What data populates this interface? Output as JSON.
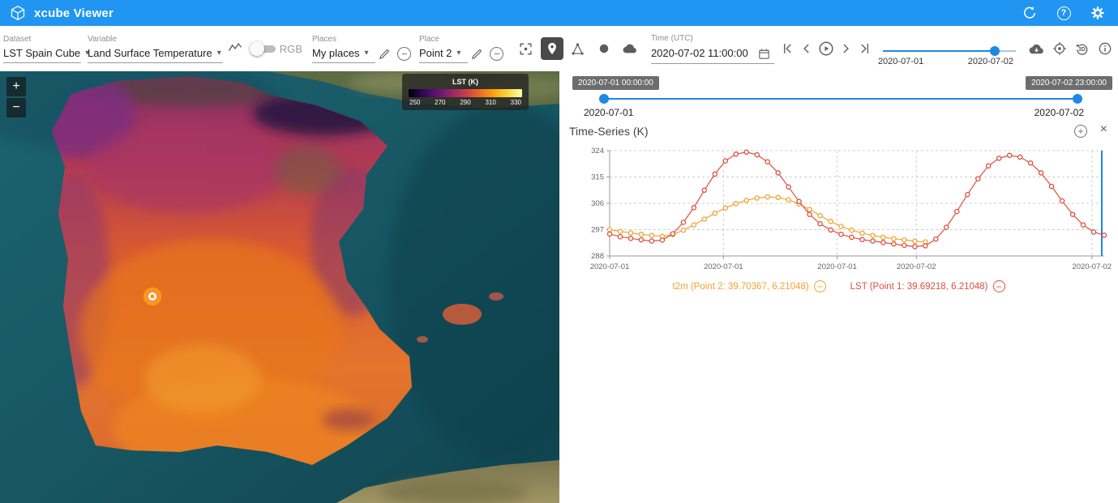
{
  "app_bar": {
    "title": "xcube Viewer"
  },
  "toolbar": {
    "dataset_label": "Dataset",
    "dataset_value": "LST Spain Cube",
    "variable_label": "Variable",
    "variable_value": "Land Surface Temperature",
    "rgb_label": "RGB",
    "places_label": "Places",
    "places_value": "My places",
    "place_label": "Place",
    "place_value": "Point 2",
    "time_label": "Time (UTC)",
    "time_value": "2020-07-02 11:00:00",
    "slider_start_label": "2020-07-01",
    "slider_end_label": "2020-07-02",
    "threesixty_text": "3D"
  },
  "map": {
    "zoom_in_label": "+",
    "zoom_out_label": "−",
    "legend_title": "LST (K)",
    "legend_ticks": [
      "250",
      "270",
      "290",
      "310",
      "330"
    ]
  },
  "time_range": {
    "start_chip": "2020-07-01 00:00:00",
    "end_chip": "2020-07-02 23:00:00",
    "start_label": "2020-07-01",
    "end_label": "2020-07-02"
  },
  "timeseries_panel": {
    "title": "Time-Series (K)"
  },
  "chart_data": {
    "type": "line",
    "title": "Time-Series (K)",
    "ylabel": "K",
    "ylim": [
      288,
      324
    ],
    "yticks": [
      288,
      297,
      306,
      315,
      324
    ],
    "x_max": 47,
    "x_unit": "hours since 2020-07-01 00:00 UTC",
    "xticks": [
      {
        "frac": 0.0,
        "label": "2020-07-01"
      },
      {
        "frac": 0.23,
        "label": "2020-07-01"
      },
      {
        "frac": 0.46,
        "label": "2020-07-01"
      },
      {
        "frac": 0.62,
        "label": "2020-07-02"
      },
      {
        "frac": 0.975,
        "label": "2020-07-02"
      }
    ],
    "grid": true,
    "legend_position": "bottom",
    "current_time_frac": 0.995,
    "current_time_color": "#1e88e5",
    "series": [
      {
        "name": "t2m (Point 2: 39.70367, 6.21048)",
        "color": "#f0a330",
        "marker": "open-circle",
        "x": [
          0,
          1,
          2,
          3,
          4,
          5,
          6,
          7,
          8,
          9,
          10,
          11,
          12,
          13,
          14,
          15,
          16,
          17,
          18,
          19,
          20,
          21,
          22,
          23,
          24,
          25,
          26,
          27,
          28,
          29,
          30
        ],
        "values": [
          297,
          296.4,
          295.9,
          295.4,
          295,
          294.7,
          295.3,
          296.8,
          298.6,
          300.6,
          302.6,
          304.4,
          305.9,
          307,
          307.8,
          308.2,
          308,
          307.2,
          305.8,
          303.9,
          301.8,
          299.8,
          298.1,
          296.8,
          295.8,
          295,
          294.4,
          293.9,
          293.5,
          293.1,
          292.8
        ]
      },
      {
        "name": "LST (Point 1: 39.69218, 6.21048)",
        "color": "#e04e3f",
        "marker": "open-circle",
        "x": [
          0,
          1,
          2,
          3,
          4,
          5,
          6,
          7,
          8,
          9,
          10,
          11,
          12,
          13,
          14,
          15,
          16,
          17,
          18,
          19,
          20,
          21,
          22,
          23,
          24,
          25,
          26,
          27,
          28,
          29,
          30,
          31,
          32,
          33,
          34,
          35,
          36,
          37,
          38,
          39,
          40,
          41,
          42,
          43,
          44,
          45,
          46,
          47
        ],
        "values": [
          295.5,
          294.6,
          294,
          293.5,
          293.1,
          293.4,
          295.6,
          299.5,
          304.5,
          310.5,
          316,
          320.5,
          322.8,
          323.5,
          322.6,
          320.2,
          316.4,
          311.6,
          306.6,
          302.2,
          299,
          296.9,
          295.4,
          294.4,
          293.6,
          293.1,
          292.6,
          292.1,
          291.6,
          291.2,
          291.5,
          293.8,
          297.8,
          303.2,
          309,
          314.4,
          318.8,
          321.4,
          322.4,
          321.8,
          319.8,
          316.4,
          311.8,
          306.8,
          302.2,
          298.6,
          296.2,
          295.1
        ]
      }
    ]
  }
}
